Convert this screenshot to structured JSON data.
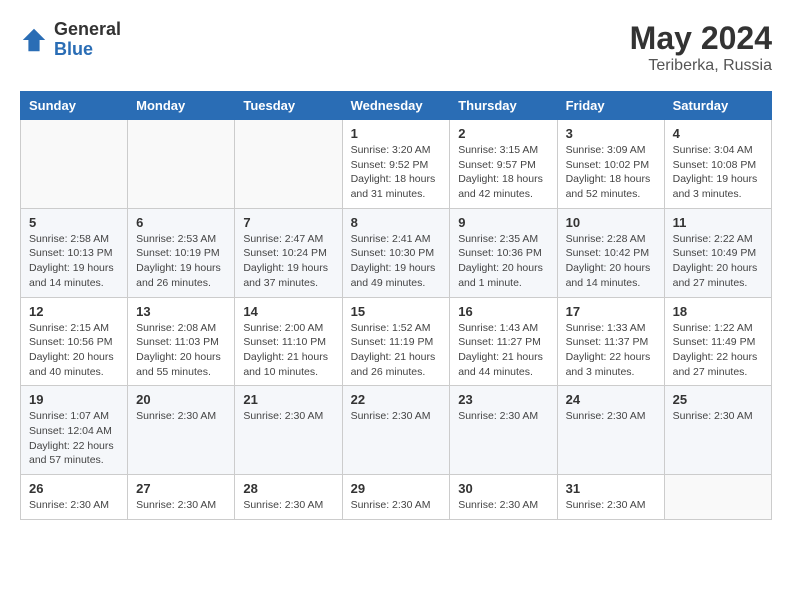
{
  "header": {
    "logo_general": "General",
    "logo_blue": "Blue",
    "month_year": "May 2024",
    "location": "Teriberka, Russia"
  },
  "calendar": {
    "days_of_week": [
      "Sunday",
      "Monday",
      "Tuesday",
      "Wednesday",
      "Thursday",
      "Friday",
      "Saturday"
    ],
    "weeks": [
      [
        {
          "day": "",
          "info": ""
        },
        {
          "day": "",
          "info": ""
        },
        {
          "day": "",
          "info": ""
        },
        {
          "day": "1",
          "info": "Sunrise: 3:20 AM\nSunset: 9:52 PM\nDaylight: 18 hours and 31 minutes."
        },
        {
          "day": "2",
          "info": "Sunrise: 3:15 AM\nSunset: 9:57 PM\nDaylight: 18 hours and 42 minutes."
        },
        {
          "day": "3",
          "info": "Sunrise: 3:09 AM\nSunset: 10:02 PM\nDaylight: 18 hours and 52 minutes."
        },
        {
          "day": "4",
          "info": "Sunrise: 3:04 AM\nSunset: 10:08 PM\nDaylight: 19 hours and 3 minutes."
        }
      ],
      [
        {
          "day": "5",
          "info": "Sunrise: 2:58 AM\nSunset: 10:13 PM\nDaylight: 19 hours and 14 minutes."
        },
        {
          "day": "6",
          "info": "Sunrise: 2:53 AM\nSunset: 10:19 PM\nDaylight: 19 hours and 26 minutes."
        },
        {
          "day": "7",
          "info": "Sunrise: 2:47 AM\nSunset: 10:24 PM\nDaylight: 19 hours and 37 minutes."
        },
        {
          "day": "8",
          "info": "Sunrise: 2:41 AM\nSunset: 10:30 PM\nDaylight: 19 hours and 49 minutes."
        },
        {
          "day": "9",
          "info": "Sunrise: 2:35 AM\nSunset: 10:36 PM\nDaylight: 20 hours and 1 minute."
        },
        {
          "day": "10",
          "info": "Sunrise: 2:28 AM\nSunset: 10:42 PM\nDaylight: 20 hours and 14 minutes."
        },
        {
          "day": "11",
          "info": "Sunrise: 2:22 AM\nSunset: 10:49 PM\nDaylight: 20 hours and 27 minutes."
        }
      ],
      [
        {
          "day": "12",
          "info": "Sunrise: 2:15 AM\nSunset: 10:56 PM\nDaylight: 20 hours and 40 minutes."
        },
        {
          "day": "13",
          "info": "Sunrise: 2:08 AM\nSunset: 11:03 PM\nDaylight: 20 hours and 55 minutes."
        },
        {
          "day": "14",
          "info": "Sunrise: 2:00 AM\nSunset: 11:10 PM\nDaylight: 21 hours and 10 minutes."
        },
        {
          "day": "15",
          "info": "Sunrise: 1:52 AM\nSunset: 11:19 PM\nDaylight: 21 hours and 26 minutes."
        },
        {
          "day": "16",
          "info": "Sunrise: 1:43 AM\nSunset: 11:27 PM\nDaylight: 21 hours and 44 minutes."
        },
        {
          "day": "17",
          "info": "Sunrise: 1:33 AM\nSunset: 11:37 PM\nDaylight: 22 hours and 3 minutes."
        },
        {
          "day": "18",
          "info": "Sunrise: 1:22 AM\nSunset: 11:49 PM\nDaylight: 22 hours and 27 minutes."
        }
      ],
      [
        {
          "day": "19",
          "info": "Sunrise: 1:07 AM\nSunset: 12:04 AM\nDaylight: 22 hours and 57 minutes."
        },
        {
          "day": "20",
          "info": "Sunrise: 2:30 AM"
        },
        {
          "day": "21",
          "info": "Sunrise: 2:30 AM"
        },
        {
          "day": "22",
          "info": "Sunrise: 2:30 AM"
        },
        {
          "day": "23",
          "info": "Sunrise: 2:30 AM"
        },
        {
          "day": "24",
          "info": "Sunrise: 2:30 AM"
        },
        {
          "day": "25",
          "info": "Sunrise: 2:30 AM"
        }
      ],
      [
        {
          "day": "26",
          "info": "Sunrise: 2:30 AM"
        },
        {
          "day": "27",
          "info": "Sunrise: 2:30 AM"
        },
        {
          "day": "28",
          "info": "Sunrise: 2:30 AM"
        },
        {
          "day": "29",
          "info": "Sunrise: 2:30 AM"
        },
        {
          "day": "30",
          "info": "Sunrise: 2:30 AM"
        },
        {
          "day": "31",
          "info": "Sunrise: 2:30 AM"
        },
        {
          "day": "",
          "info": ""
        }
      ]
    ]
  }
}
